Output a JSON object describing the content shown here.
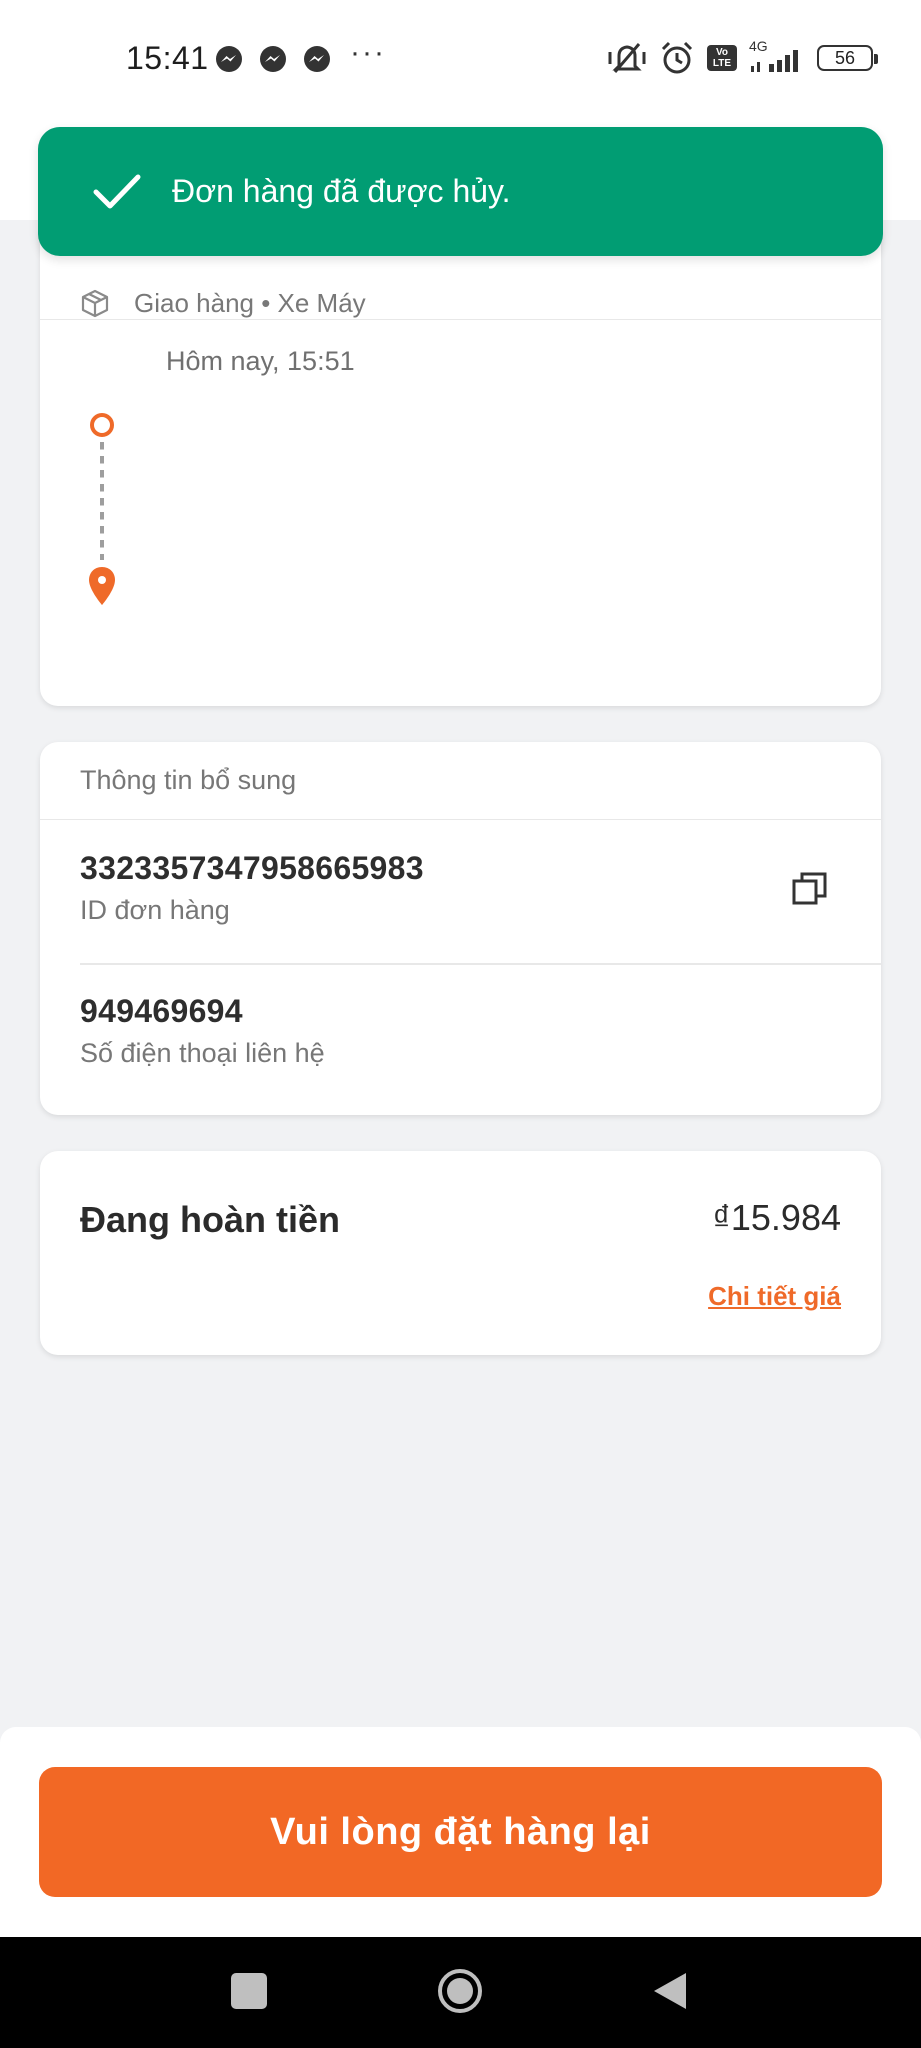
{
  "status_bar": {
    "time": "15:41",
    "dots": "···",
    "network": "4G",
    "battery": "56",
    "volte": "Vo LTE"
  },
  "toast": {
    "message": "Đơn hàng đã được hủy.",
    "color": "#019d73"
  },
  "route": {
    "delivery_type": "Giao hàng • Xe Máy",
    "time": "Hôm nay, 15:51"
  },
  "info": {
    "header": "Thông tin bổ sung",
    "order_id": "3323357347958665983",
    "order_id_label": "ID đơn hàng",
    "phone": "949469694",
    "phone_label": "Số điện thoại liên hệ"
  },
  "refund": {
    "label": "Đang hoàn tiền",
    "amount": "₫15.984",
    "price_detail_link": "Chi tiết giá"
  },
  "footer": {
    "reorder_button": "Vui lòng đặt hàng lại",
    "accent": "#f26825"
  },
  "icons": {
    "messenger": "messenger-icon",
    "mute": "vibrate-mute-icon",
    "alarm": "alarm-icon",
    "signal": "signal-icon",
    "package": "package-icon",
    "copy": "copy-icon"
  }
}
